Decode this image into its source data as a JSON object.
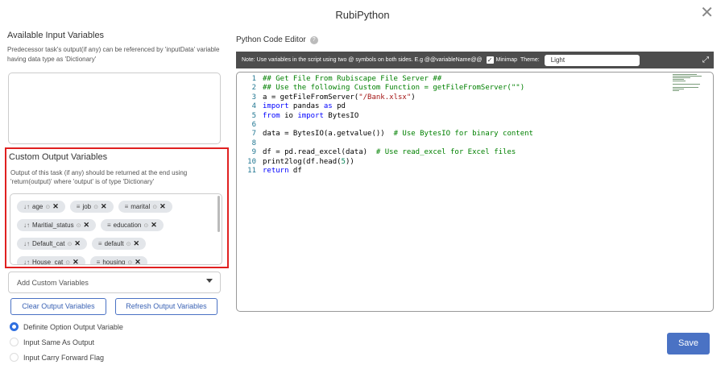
{
  "window": {
    "title": "RubiPython"
  },
  "input_vars": {
    "heading": "Available Input Variables",
    "description": "Predecessor task's output(if any) can be referenced by 'inputData' variable having data type as 'Dictionary'"
  },
  "output_vars": {
    "heading": "Custom Output Variables",
    "description": "Output of this task (if any) should be returned at the end using 'return(output)' where 'output' is of type 'Dictionary'",
    "chips": [
      {
        "label": "age",
        "icon": "sort-numeric-icon"
      },
      {
        "label": "job",
        "icon": "text-lines-icon"
      },
      {
        "label": "marital",
        "icon": "text-lines-icon"
      },
      {
        "label": "Maritial_status",
        "icon": "sort-numeric-icon"
      },
      {
        "label": "education",
        "icon": "text-lines-icon"
      },
      {
        "label": "Default_cat",
        "icon": "sort-numeric-icon"
      },
      {
        "label": "default",
        "icon": "text-lines-icon"
      },
      {
        "label": "House_cat",
        "icon": "sort-numeric-icon"
      },
      {
        "label": "housing",
        "icon": "text-lines-icon"
      }
    ]
  },
  "add_custom": {
    "placeholder": "Add Custom Variables"
  },
  "buttons": {
    "clear": "Clear Output Variables",
    "refresh": "Refresh Output Variables",
    "save": "Save"
  },
  "options": [
    {
      "label": "Definite Option Output Variable",
      "selected": true
    },
    {
      "label": "Input Same As Output",
      "selected": false
    },
    {
      "label": "Input Carry Forward Flag",
      "selected": false
    }
  ],
  "editor": {
    "label": "Python Code Editor",
    "note": "Note: Use variables in the script using two @ symbols on both sides. E.g @@variableName@@",
    "minimap_label": "Minimap",
    "minimap_checked": true,
    "theme_label": "Theme:",
    "theme_value": "Light",
    "lines": [
      "## Get File From Rubiscape File Server ##",
      "## Use the following Custom Function = getFileFromServer(\"\")",
      "a = getFileFromServer(\"/Bank.xlsx\")",
      "import pandas as pd",
      "from io import BytesIO",
      "",
      "data = BytesIO(a.getvalue())  # Use BytesIO for binary content",
      "",
      "df = pd.read_excel(data)  # Use read_excel for Excel files",
      "print2log(df.head(5))",
      "return df"
    ],
    "line_numbers": [
      "1",
      "2",
      "3",
      "4",
      "5",
      "6",
      "7",
      "8",
      "9",
      "10",
      "11"
    ]
  },
  "colors": {
    "accent": "#4a72c4",
    "highlight_border": "#e02020",
    "toolbar_bg": "#4d4d4d"
  }
}
